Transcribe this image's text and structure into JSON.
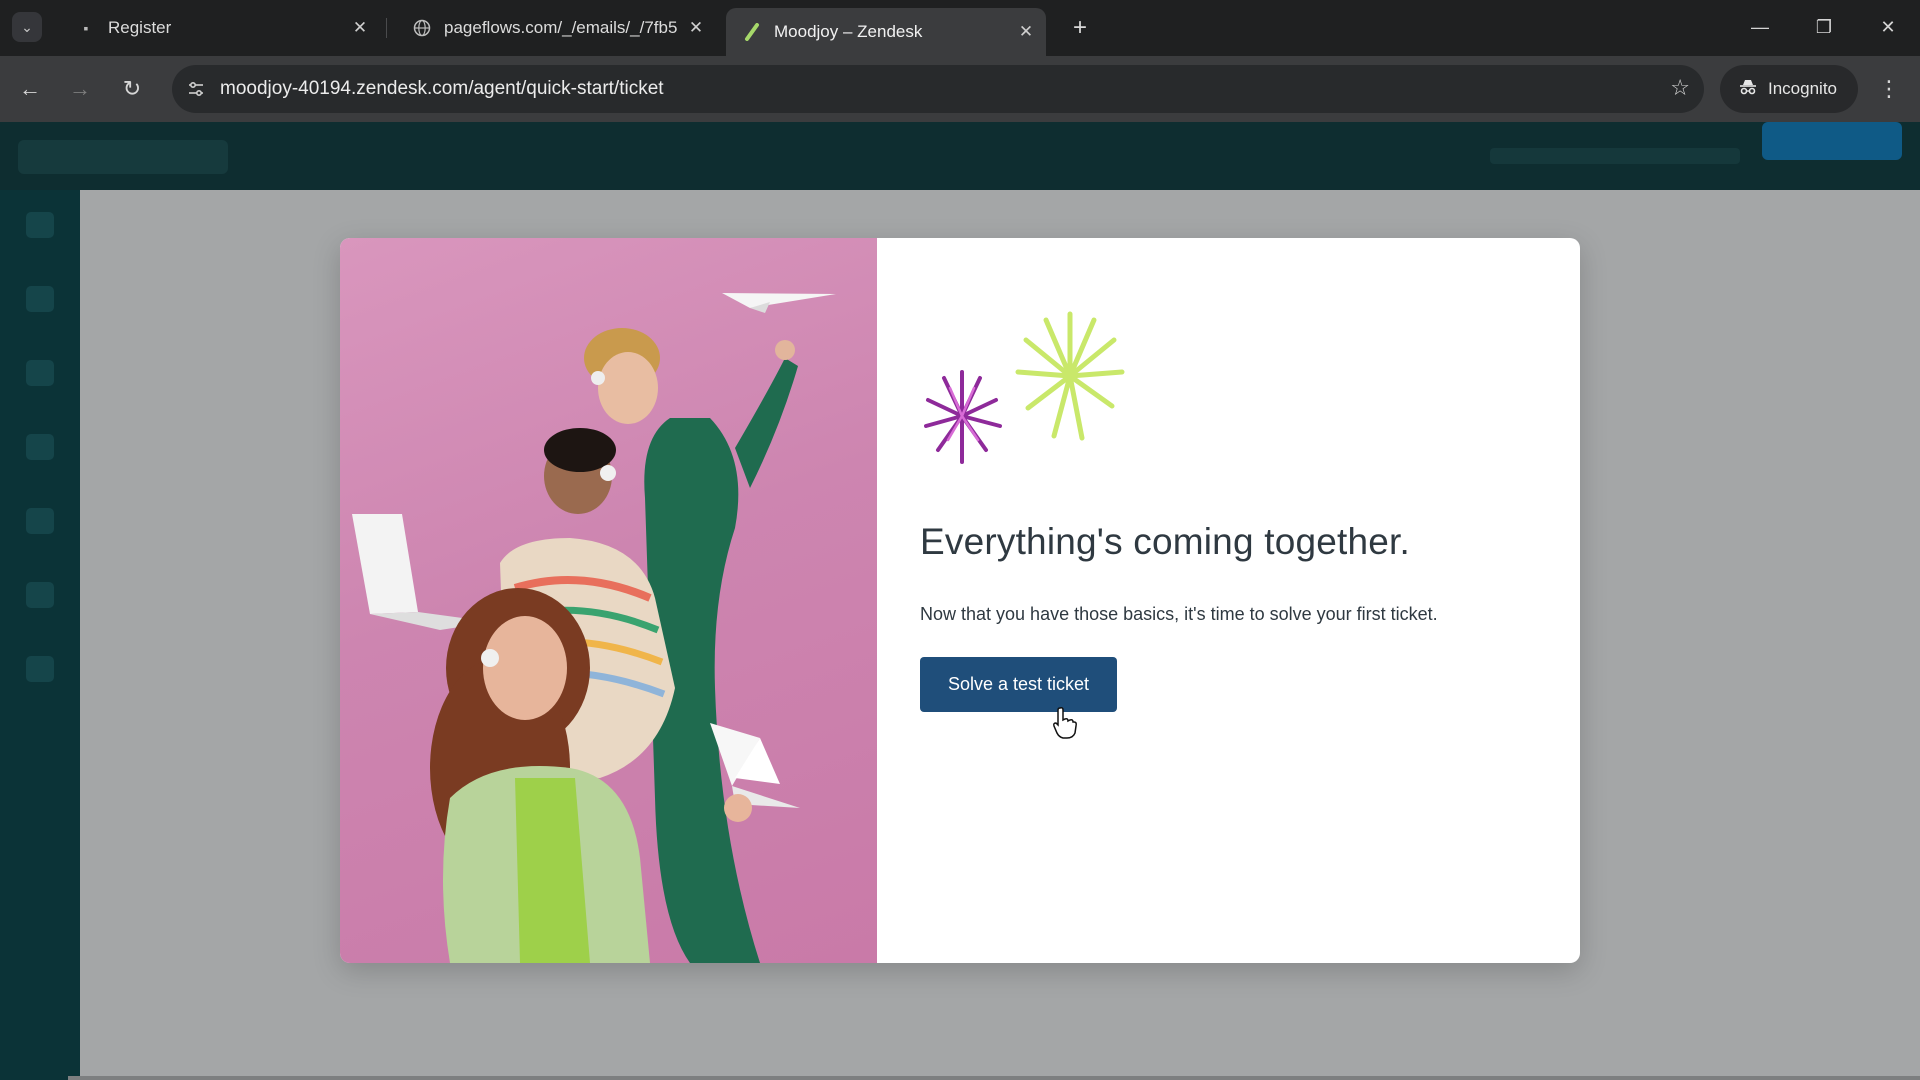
{
  "browser": {
    "tabs": [
      {
        "title": "Register",
        "active": false
      },
      {
        "title": "pageflows.com/_/emails/_/7fb5",
        "active": false
      },
      {
        "title": "Moodjoy – Zendesk",
        "active": true
      }
    ],
    "url": "moodjoy-40194.zendesk.com/agent/quick-start/ticket",
    "incognito_label": "Incognito"
  },
  "modal": {
    "headline": "Everything's coming together.",
    "subtext": "Now that you have those basics, it's time to solve your first ticket.",
    "cta_label": "Solve a test ticket"
  },
  "colors": {
    "cta_background": "#1f4e7a",
    "hero_background": "#cd85b0",
    "app_header": "#0e2d30",
    "firework_purple": "#8e2a9a",
    "firework_green": "#c9e86a"
  }
}
